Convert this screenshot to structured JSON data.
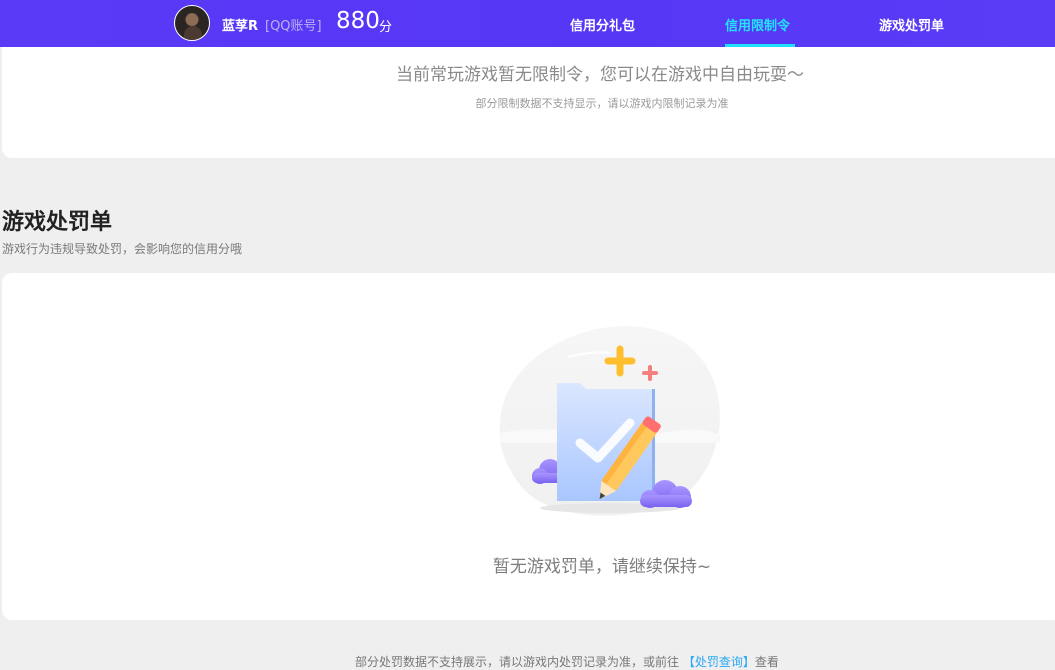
{
  "header": {
    "nickname": "蓝莩R",
    "account_type": "[QQ账号]",
    "score": "880",
    "score_unit": "分",
    "nav": [
      {
        "label": "信用分礼包",
        "active": false
      },
      {
        "label": "信用限制令",
        "active": true
      },
      {
        "label": "游戏处罚单",
        "active": false
      }
    ],
    "accent_color": "#5637f5",
    "active_color": "#22e4ff"
  },
  "limit_card": {
    "message": "当前常玩游戏暂无限制令，您可以在游戏中自由玩耍～",
    "note": "部分限制数据不支持显示，请以游戏内限制记录为准"
  },
  "penalty_section": {
    "title": "游戏处罚单",
    "subtitle": "游戏行为违规导致处罚，会影响您的信用分哦",
    "empty_message": "暂无游戏罚单，请继续保持~",
    "illustration": "document-check-pencil-icon"
  },
  "footer": {
    "text_before": "部分处罚数据不支持展示，请以游戏内处罚记录为准，或前往",
    "link_label": "【处罚查询】",
    "text_after": "查看"
  }
}
